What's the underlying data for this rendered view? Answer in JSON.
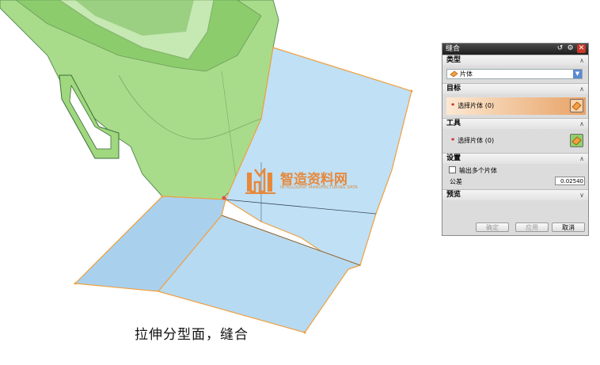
{
  "caption": "拉伸分型面，缝合",
  "watermark": {
    "main": "智造资料网",
    "sub": "INTELLIGENT MANUFACTURING DATA"
  },
  "dialog": {
    "title": "缝合",
    "sections": {
      "type": {
        "header": "类型",
        "selected": "片体"
      },
      "target": {
        "header": "目标",
        "prompt": "选择片体 (0)"
      },
      "tool": {
        "header": "工具",
        "prompt": "选择片体 (0)"
      },
      "settings": {
        "header": "设置",
        "checkbox_label": "输出多个片体",
        "tolerance_label": "公差",
        "tolerance_value": "0.02540"
      },
      "preview": {
        "header": "预览"
      }
    },
    "buttons": {
      "ok": "确定",
      "apply": "应用",
      "cancel": "取消"
    }
  },
  "colors": {
    "part_green": "#9fd87f",
    "surface_blue": "#bcdff5",
    "selection_orange": "#f0a040",
    "accent_orange": "#e8883a"
  }
}
